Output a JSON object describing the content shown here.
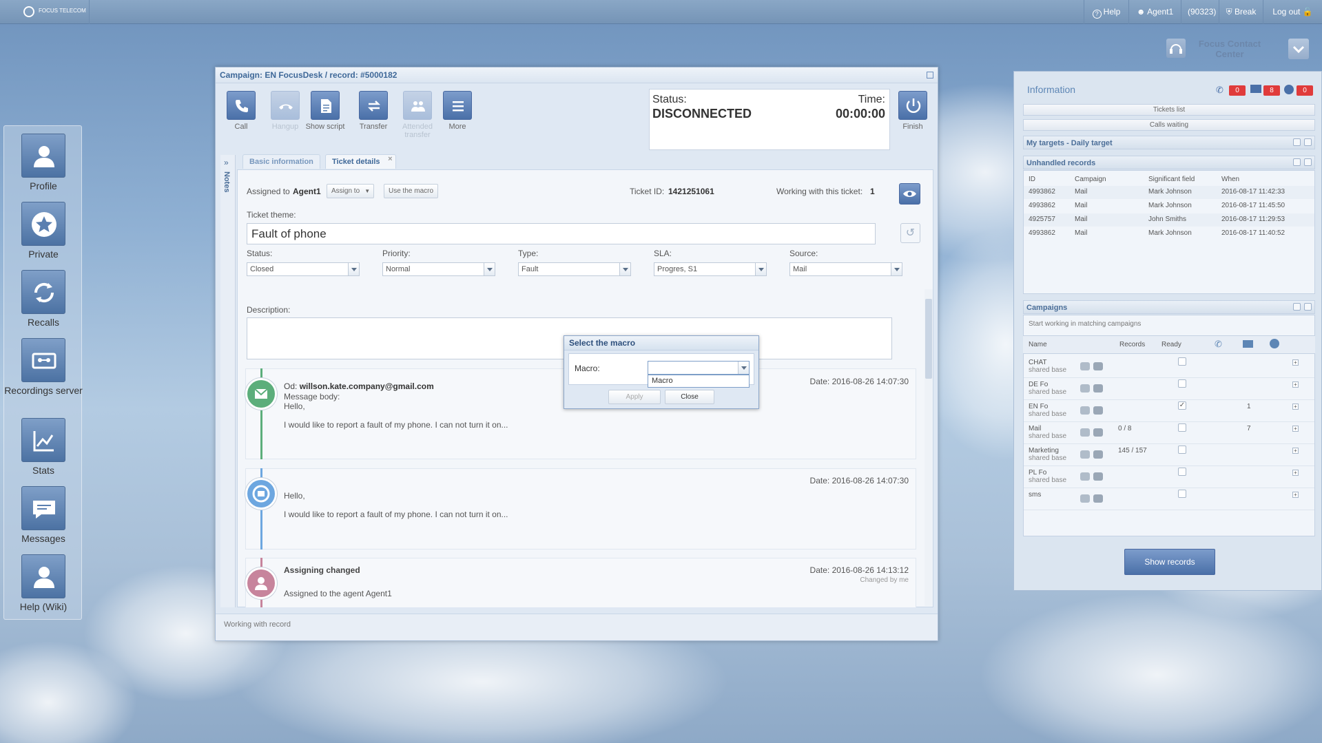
{
  "topbar": {
    "help": "Help",
    "agent": "Agent1",
    "agent_id": "(90323)",
    "break": "Break",
    "logout": "Log out",
    "logo": "FOCUS TELECOM"
  },
  "sidebar": {
    "items": [
      "Profile",
      "Private",
      "Recalls",
      "Recordings server",
      "Stats",
      "Messages",
      "Help (Wiki)"
    ]
  },
  "window": {
    "title": "Campaign: EN FocusDesk / record: #5000182",
    "toolbar": {
      "call": "Call",
      "hangup": "Hangup",
      "show_script": "Show script",
      "transfer": "Transfer",
      "attended_transfer": "Attended transfer",
      "more": "More",
      "finish": "Finish"
    },
    "status_label": "Status:",
    "status_value": "DISCONNECTED",
    "time_label": "Time:",
    "time_value": "00:00:00",
    "notes": "Notes",
    "tabs": [
      "Basic information",
      "Ticket details"
    ],
    "ticket": {
      "assigned_label": "Assigned to",
      "assigned_agent": "Agent1",
      "assign_to_btn": "Assign to",
      "use_macro_btn": "Use the macro",
      "ticket_id_label": "Ticket ID:",
      "ticket_id": "1421251061",
      "working_label": "Working with this ticket:",
      "working_count": "1",
      "theme_label": "Ticket theme:",
      "theme_value": "Fault of phone",
      "fields": [
        {
          "label": "Status:",
          "value": "Closed"
        },
        {
          "label": "Priority:",
          "value": "Normal"
        },
        {
          "label": "Type:",
          "value": "Fault"
        },
        {
          "label": "SLA:",
          "value": "Progres, S1"
        },
        {
          "label": "Source:",
          "value": "Mail"
        }
      ],
      "description_label": "Description:"
    },
    "history": [
      {
        "from_label": "Od:",
        "from": "willson.kate.company@gmail.com",
        "body_label": "Message body:",
        "greeting": "Hello,",
        "text": "I would like to report a fault of my phone. I can not turn it on...",
        "date": "Date: 2016-08-26 14:07:30",
        "color": "#5cae7b"
      },
      {
        "greeting": "Hello,",
        "text": "I would like to report a fault of my phone. I can not turn it on...",
        "date": "Date: 2016-08-26 14:07:30",
        "color": "#6da7e0"
      },
      {
        "title": "Assigning changed",
        "text": "Assigned to the agent Agent1",
        "date": "Date: 2016-08-26 14:13:12",
        "changed": "Changed by me",
        "color": "#c7849c"
      }
    ],
    "footer": "Working with record"
  },
  "modal": {
    "title": "Select the macro",
    "label": "Macro:",
    "option": "Macro",
    "apply": "Apply",
    "close": "Close"
  },
  "right": {
    "title": "Information",
    "badge_calls": "0",
    "badge_mail": "8",
    "badge_other": "0",
    "fcc_title": "Focus Contact Center",
    "tickets_list": "Tickets list",
    "calls_waiting": "Calls waiting",
    "targets": "My targets - Daily target",
    "unhandled": "Unhandled records",
    "unhandled_cols": [
      "ID",
      "Campaign",
      "Significant field",
      "When"
    ],
    "unhandled_rows": [
      [
        "4993862",
        "Mail",
        "Mark Johnson",
        "2016-08-17 11:42:33"
      ],
      [
        "4993862",
        "Mail",
        "Mark Johnson",
        "2016-08-17 11:45:50"
      ],
      [
        "4925757",
        "Mail",
        "John Smiths",
        "2016-08-17 11:29:53"
      ],
      [
        "4993862",
        "Mail",
        "Mark Johnson",
        "2016-08-17 11:40:52"
      ]
    ],
    "campaigns": "Campaigns",
    "campaigns_hint": "Start working in matching campaigns",
    "campaign_cols": [
      "Name",
      "Records",
      "Ready"
    ],
    "campaign_rows": [
      {
        "name": "CHAT",
        "sub": "shared base",
        "records": "",
        "ready": false,
        "count": ""
      },
      {
        "name": "DE Fo",
        "sub": "shared base",
        "records": "",
        "ready": false,
        "count": ""
      },
      {
        "name": "EN Fo",
        "sub": "shared base",
        "records": "",
        "ready": true,
        "count": "1"
      },
      {
        "name": "Mail",
        "sub": "shared base",
        "records": "0 / 8",
        "ready": false,
        "count": "7"
      },
      {
        "name": "Marketing",
        "sub": "shared base",
        "records": "145 / 157",
        "ready": false,
        "count": ""
      },
      {
        "name": "PL Fo",
        "sub": "shared base",
        "records": "",
        "ready": false,
        "count": ""
      },
      {
        "name": "sms",
        "sub": "",
        "records": "",
        "ready": false,
        "count": ""
      }
    ],
    "show_records": "Show records"
  },
  "colors": {
    "accent": "#4a70a8",
    "badge": "#e03b3b",
    "green": "#5cae7b",
    "blue": "#6da7e0",
    "pink": "#c7849c"
  }
}
